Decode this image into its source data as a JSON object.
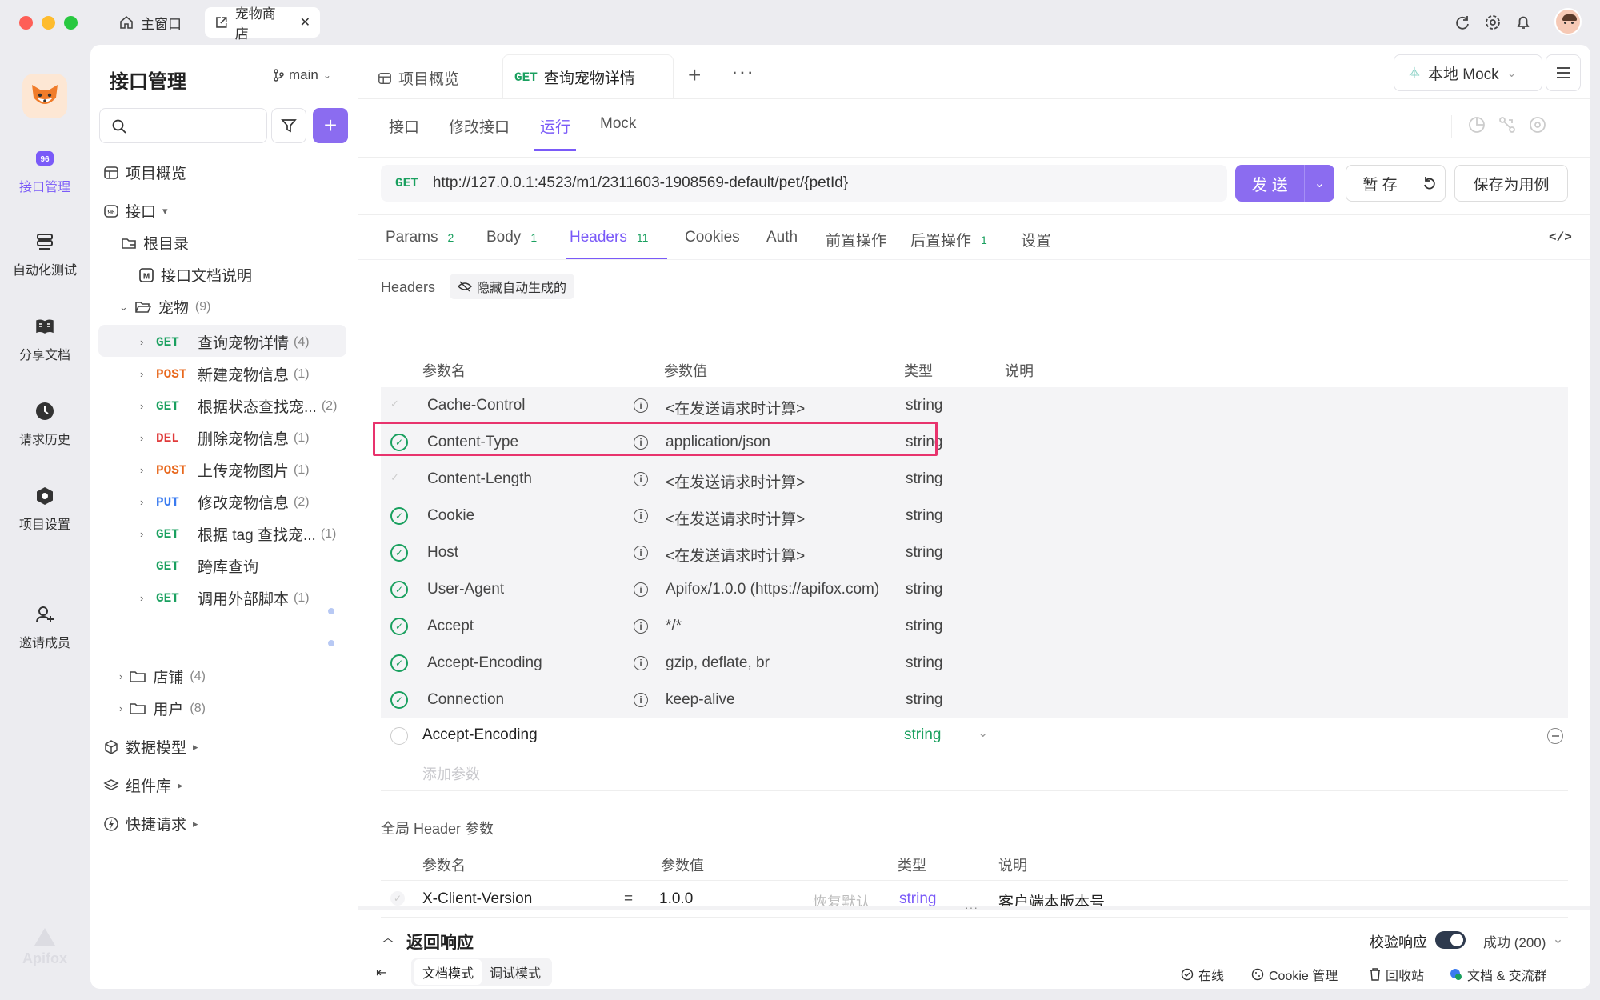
{
  "window_tabs": [
    {
      "label": "主窗口"
    },
    {
      "label": "宠物商店"
    }
  ],
  "rail": [
    {
      "label": "接口管理"
    },
    {
      "label": "自动化测试"
    },
    {
      "label": "分享文档"
    },
    {
      "label": "请求历史"
    },
    {
      "label": "项目设置"
    },
    {
      "label": "邀请成员"
    }
  ],
  "rail_logo": "Apifox",
  "sidebar": {
    "title": "接口管理",
    "branch": "main",
    "search_placeholder": "",
    "tree": {
      "overview": "项目概览",
      "api_root": "接口",
      "root_dir": "根目录",
      "doc_note": "接口文档说明",
      "pet_folder": "宠物",
      "pet_count": "(9)",
      "endpoints": [
        {
          "method": "GET",
          "name": "查询宠物详情",
          "count": "(4)"
        },
        {
          "method": "POST",
          "name": "新建宠物信息",
          "count": "(1)"
        },
        {
          "method": "GET",
          "name": "根据状态查找宠...",
          "count": "(2)"
        },
        {
          "method": "DEL",
          "name": "删除宠物信息",
          "count": "(1)"
        },
        {
          "method": "POST",
          "name": "上传宠物图片",
          "count": "(1)"
        },
        {
          "method": "PUT",
          "name": "修改宠物信息",
          "count": "(2)"
        },
        {
          "method": "GET",
          "name": "根据 tag 查找宠...",
          "count": "(1)"
        },
        {
          "method": "GET",
          "name": "跨库查询",
          "count": ""
        },
        {
          "method": "GET",
          "name": "调用外部脚本",
          "count": "(1)"
        }
      ],
      "shop_folder": "店铺",
      "shop_count": "(4)",
      "user_folder": "用户",
      "user_count": "(8)",
      "data_models": "数据模型",
      "components": "组件库",
      "quick_request": "快捷请求"
    }
  },
  "main": {
    "doc_tabs": [
      {
        "label": "项目概览"
      },
      {
        "method": "GET",
        "label": "查询宠物详情"
      }
    ],
    "env": "本地 Mock",
    "env_badge": "本",
    "sub_tabs": [
      "接口",
      "修改接口",
      "运行",
      "Mock"
    ],
    "request": {
      "method": "GET",
      "url": "http://127.0.0.1:4523/m1/2311603-1908569-default/pet/{petId}",
      "send": "发 送",
      "save_temp": "暂 存",
      "save_case": "保存为用例"
    },
    "param_tabs": [
      {
        "label": "Params",
        "count": "2"
      },
      {
        "label": "Body",
        "count": "1"
      },
      {
        "label": "Headers",
        "count": "11"
      },
      {
        "label": "Cookies",
        "count": ""
      },
      {
        "label": "Auth",
        "count": ""
      },
      {
        "label": "前置操作",
        "count": ""
      },
      {
        "label": "后置操作",
        "count": "1"
      },
      {
        "label": "设置",
        "count": ""
      }
    ],
    "headers_section": {
      "title": "Headers",
      "hide_auto": "隐藏自动生成的",
      "columns": [
        "参数名",
        "参数值",
        "类型",
        "说明"
      ],
      "rows": [
        {
          "name": "Cache-Control",
          "value": "<在发送请求时计算>",
          "type": "string"
        },
        {
          "name": "Content-Type",
          "value": "application/json",
          "type": "string"
        },
        {
          "name": "Content-Length",
          "value": "<在发送请求时计算>",
          "type": "string"
        },
        {
          "name": "Cookie",
          "value": "<在发送请求时计算>",
          "type": "string"
        },
        {
          "name": "Host",
          "value": "<在发送请求时计算>",
          "type": "string"
        },
        {
          "name": "User-Agent",
          "value": "Apifox/1.0.0 (https://apifox.com)",
          "type": "string"
        },
        {
          "name": "Accept",
          "value": "*/*",
          "type": "string"
        },
        {
          "name": "Accept-Encoding",
          "value": "gzip, deflate, br",
          "type": "string"
        },
        {
          "name": "Connection",
          "value": "keep-alive",
          "type": "string"
        }
      ],
      "custom_row": {
        "name": "Accept-Encoding",
        "type": "string"
      },
      "add_param": "添加参数"
    },
    "global_section": {
      "title": "全局 Header 参数",
      "columns": [
        "参数名",
        "参数值",
        "类型",
        "说明"
      ],
      "row": {
        "name": "X-Client-Version",
        "op": "=",
        "value": "1.0.0",
        "restore": "恢复默认",
        "type": "string",
        "desc": "客户端本版本号"
      }
    },
    "response": {
      "title": "返回响应",
      "validate": "校验响应",
      "status": "成功 (200)"
    }
  },
  "footer": {
    "modes": [
      "文档模式",
      "调试模式"
    ],
    "online": "在线",
    "cookie": "Cookie 管理",
    "trash": "回收站",
    "docs": "文档 & 交流群"
  },
  "colors": {
    "accent": "#8b6cf0",
    "get": "#1aa05f",
    "post": "#e8681d",
    "del": "#e03b3b",
    "put": "#3a7bf0",
    "highlight": "#e8336d"
  }
}
